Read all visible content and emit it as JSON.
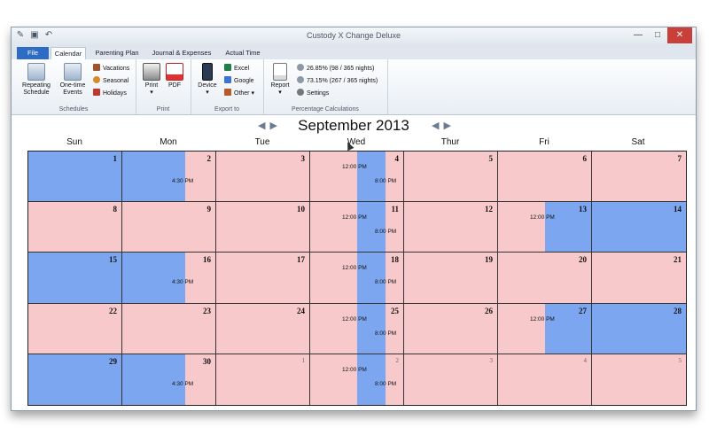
{
  "window": {
    "title": "Custody X Change Deluxe"
  },
  "tabs": [
    {
      "label": "File"
    },
    {
      "label": "Calendar"
    },
    {
      "label": "Parenting Plan"
    },
    {
      "label": "Journal & Expenses"
    },
    {
      "label": "Actual Time"
    }
  ],
  "ribbon": {
    "schedules": {
      "label": "Schedules",
      "repeating": "Repeating Schedule",
      "onetime": "One-time Events",
      "vacations": "Vacations",
      "seasonal": "Seasonal",
      "holidays": "Holidays"
    },
    "print": {
      "label": "Print",
      "print": "Print",
      "pdf": "PDF"
    },
    "export": {
      "label": "Export to",
      "device": "Device",
      "excel": "Excel",
      "google": "Google",
      "other": "Other"
    },
    "percent": {
      "label": "Percentage Calculations",
      "report": "Report",
      "p1": "26.85% (98 / 365 nights)",
      "p2": "73.15% (267 / 365 nights)",
      "settings": "Settings"
    }
  },
  "calendar": {
    "month": "September 2013",
    "days_of_week": [
      "Sun",
      "Mon",
      "Tue",
      "Wed",
      "Thur",
      "Fri",
      "Sat"
    ],
    "weeks": [
      [
        "1",
        "2",
        "3",
        "4",
        "5",
        "6",
        "7"
      ],
      [
        "8",
        "9",
        "10",
        "11",
        "12",
        "13",
        "14"
      ],
      [
        "15",
        "16",
        "17",
        "18",
        "19",
        "20",
        "21"
      ],
      [
        "22",
        "23",
        "24",
        "25",
        "26",
        "27",
        "28"
      ],
      [
        "29",
        "30",
        "1",
        "2",
        "3",
        "4",
        "5"
      ]
    ],
    "times": {
      "mon_exchange": "4:30 PM",
      "wed_start": "12:00 PM",
      "wed_end": "8:00 PM",
      "fri_exchange": "12:00 PM"
    }
  },
  "colors": {
    "parent_a": "#7ca7f0",
    "parent_b": "#f7c9ca"
  }
}
